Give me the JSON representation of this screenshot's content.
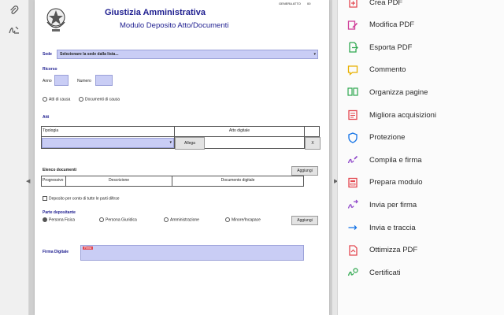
{
  "header": {
    "title": "Giustizia Amministrativa",
    "subtitle": "Modulo Deposito Atto/Documenti",
    "top_right_1": "GENERA ATTO",
    "top_right_2": "00"
  },
  "form": {
    "sede_label": "Sede",
    "sede_value": "Selezionare la sede dalla lista...",
    "ricorso_label": "Ricorso",
    "anno_label": "Anno",
    "numero_label": "Numero",
    "atti_causa": "Atti di causa",
    "documenti_causa": "Documenti di causa",
    "atti_label": "Atti",
    "tipologia_header": "Tipologia",
    "atto_digitale_header": "Atto digitale",
    "allega_button": "Allega",
    "remove_button": "X",
    "elenco_label": "Elenco documenti",
    "aggiungi_button": "Aggiungi",
    "col_progressivo": "Progressivo",
    "col_descrizione": "Descrizione",
    "col_documento": "Documento digitale",
    "deposito_check": "Deposito per conto di tutte le parti difese",
    "parte_label": "Parte depositante",
    "opt_persona_fisica": "Persona Fisica",
    "opt_persona_giuridica": "Persona Giuridica",
    "opt_amministrazione": "Amministrazione",
    "opt_minore": "Minore/Incapace",
    "aggiungi_button_2": "Aggiungi",
    "firma_label": "Firma Digitale",
    "firma_tag": "Firma"
  },
  "tools": [
    {
      "label": "Crea PDF",
      "icon": "create-pdf-icon",
      "color": "#e34850"
    },
    {
      "label": "Modifica PDF",
      "icon": "edit-pdf-icon",
      "color": "#d0409a"
    },
    {
      "label": "Esporta PDF",
      "icon": "export-pdf-icon",
      "color": "#2fa84f"
    },
    {
      "label": "Commento",
      "icon": "comment-icon",
      "color": "#e8b100"
    },
    {
      "label": "Organizza pagine",
      "icon": "organize-pages-icon",
      "color": "#2fa84f"
    },
    {
      "label": "Migliora acquisizioni",
      "icon": "enhance-scans-icon",
      "color": "#e34850"
    },
    {
      "label": "Protezione",
      "icon": "protect-icon",
      "color": "#1473e6"
    },
    {
      "label": "Compila e firma",
      "icon": "fill-sign-icon",
      "color": "#8e45c9"
    },
    {
      "label": "Prepara modulo",
      "icon": "prepare-form-icon",
      "color": "#e34850"
    },
    {
      "label": "Invia per firma",
      "icon": "send-sign-icon",
      "color": "#8e45c9"
    },
    {
      "label": "Invia e traccia",
      "icon": "send-track-icon",
      "color": "#1473e6"
    },
    {
      "label": "Ottimizza PDF",
      "icon": "optimize-pdf-icon",
      "color": "#e34850"
    },
    {
      "label": "Certificati",
      "icon": "certificates-icon",
      "color": "#2fa84f"
    }
  ],
  "colors": {
    "form_field": "#c9cdf5",
    "section_blue": "#1d1d8f",
    "title_blue": "#1d1d8f"
  }
}
